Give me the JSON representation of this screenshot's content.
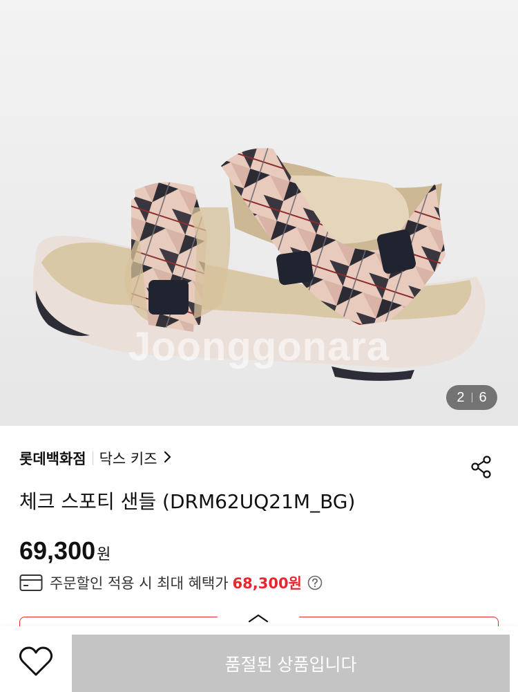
{
  "gallery": {
    "watermark": "Joonggonara",
    "current": "2",
    "total": "6"
  },
  "product": {
    "brand": "롯데백화점",
    "category": "닥스 키즈",
    "title": "체크 스포티 샌들 (DRM62UQ21M_BG)",
    "price": "69,300",
    "currency": "원",
    "benefit_label": "주문할인 적용 시 최대 혜택가",
    "benefit_price": "68,300원"
  },
  "icons": {
    "share": "share-icon",
    "card": "credit-card-icon",
    "help": "question-circle-icon",
    "collapse": "chevron-up-icon",
    "wish": "heart-outline-icon",
    "category_arrow": "chevron-right-icon"
  },
  "bottom_bar": {
    "soldout_label": "품절된 상품입니다"
  },
  "colors": {
    "accent_red": "#e8262f",
    "disabled_gray": "#c4c4c4"
  }
}
